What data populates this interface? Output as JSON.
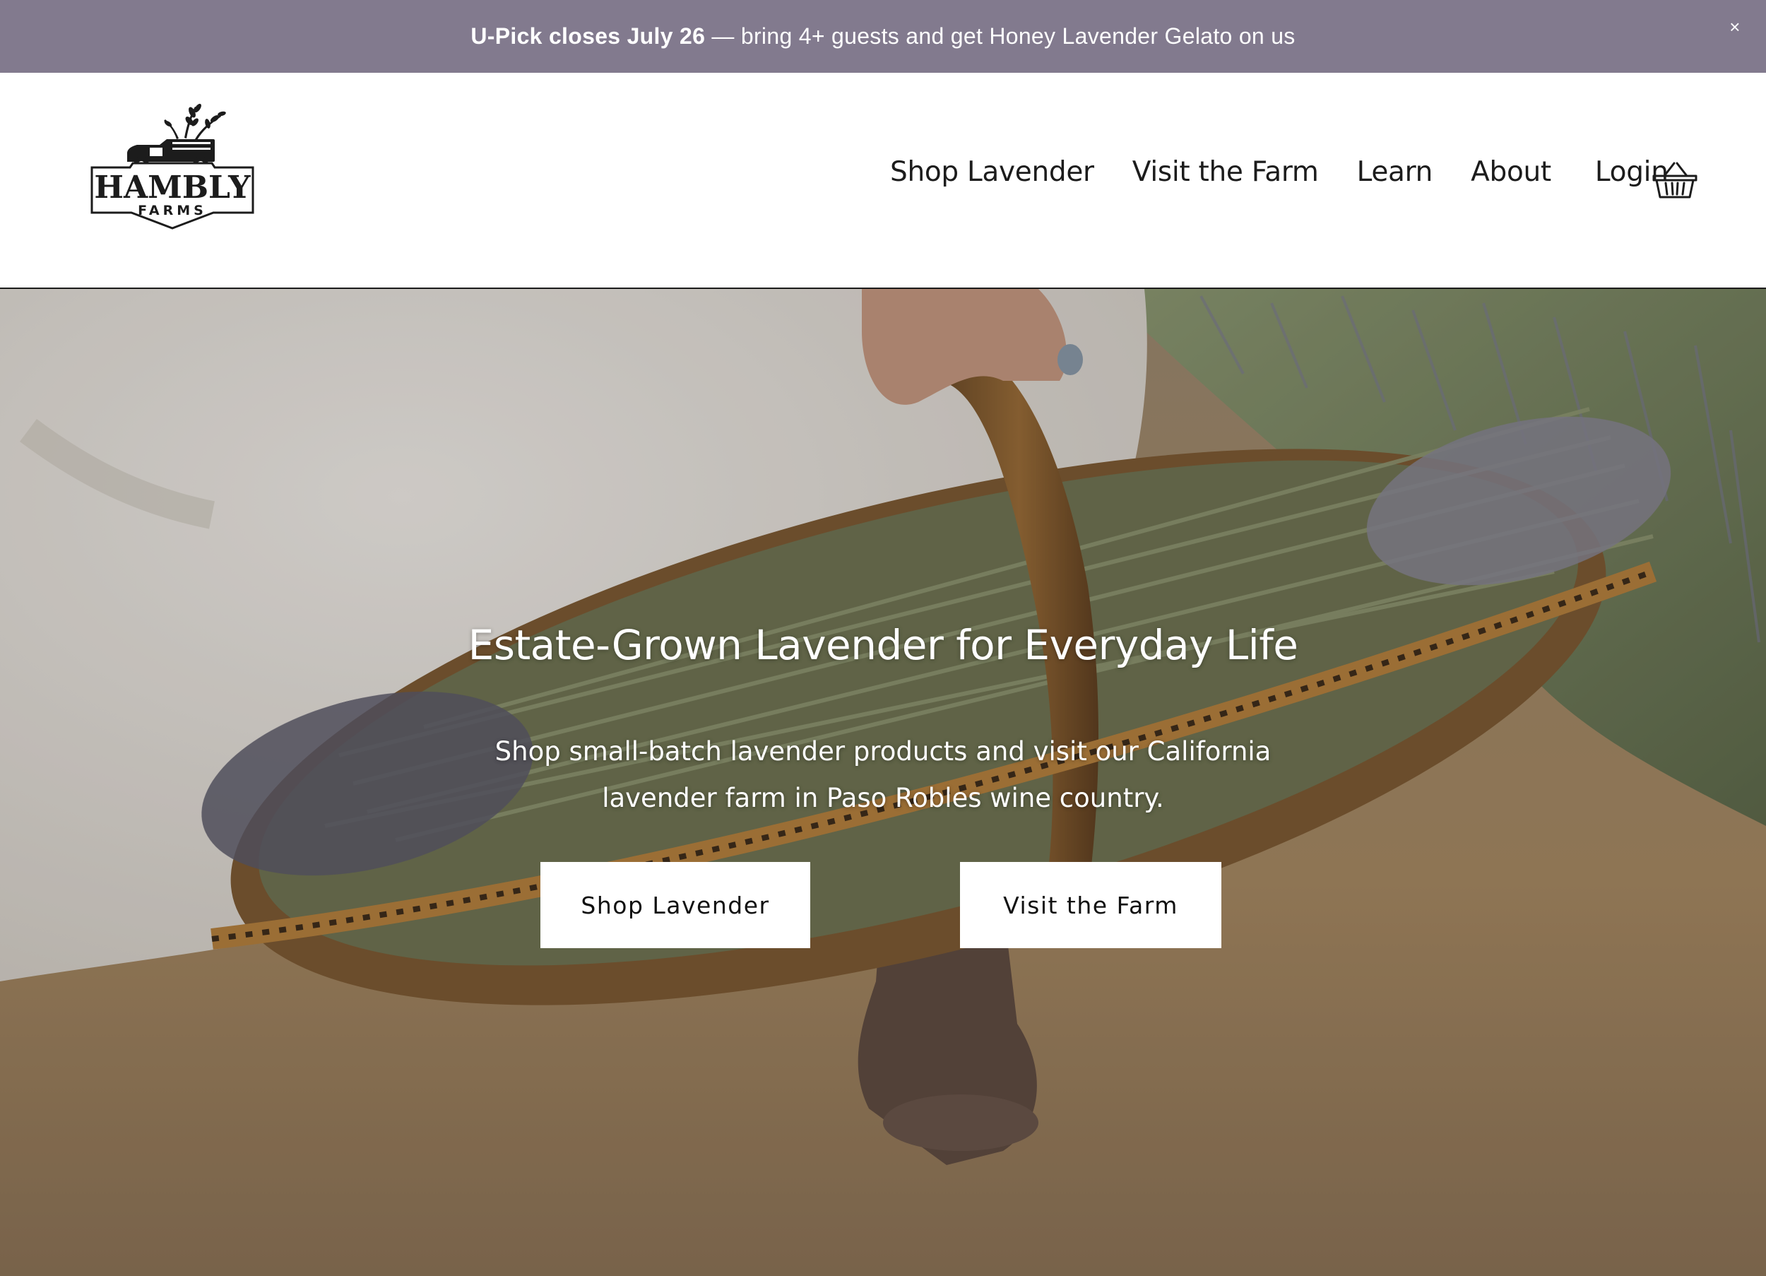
{
  "announcement": {
    "bold_text": "U-Pick closes July 26",
    "rest_text": " — bring 4+ guests and get Honey Lavender Gelato on us",
    "close_symbol": "×"
  },
  "header": {
    "logo": {
      "name": "HAMBLY",
      "sub": "FARMS",
      "icon": "truck-with-lavender-logo"
    },
    "nav": [
      {
        "label": "Shop Lavender"
      },
      {
        "label": "Visit the Farm"
      },
      {
        "label": "Learn"
      },
      {
        "label": "About"
      },
      {
        "label": "Login"
      }
    ],
    "cart_icon": "basket-icon"
  },
  "hero": {
    "title": "Estate-Grown Lavender for Everyday Life",
    "subtitle": "Shop small-batch lavender products and visit our California lavender farm in Paso Robles wine country.",
    "buttons": {
      "shop": "Shop Lavender",
      "visit": "Visit the Farm"
    }
  },
  "colors": {
    "announcement_bg": "#827a8e",
    "header_bg": "#ffffff",
    "text_dark": "#1c1c1c",
    "button_bg": "#ffffff"
  }
}
